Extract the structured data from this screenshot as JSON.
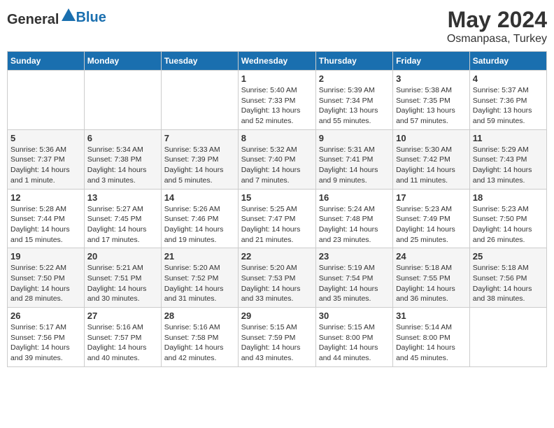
{
  "header": {
    "logo_general": "General",
    "logo_blue": "Blue",
    "month": "May 2024",
    "location": "Osmanpasa, Turkey"
  },
  "weekdays": [
    "Sunday",
    "Monday",
    "Tuesday",
    "Wednesday",
    "Thursday",
    "Friday",
    "Saturday"
  ],
  "weeks": [
    [
      {
        "day": "",
        "info": ""
      },
      {
        "day": "",
        "info": ""
      },
      {
        "day": "",
        "info": ""
      },
      {
        "day": "1",
        "info": "Sunrise: 5:40 AM\nSunset: 7:33 PM\nDaylight: 13 hours\nand 52 minutes."
      },
      {
        "day": "2",
        "info": "Sunrise: 5:39 AM\nSunset: 7:34 PM\nDaylight: 13 hours\nand 55 minutes."
      },
      {
        "day": "3",
        "info": "Sunrise: 5:38 AM\nSunset: 7:35 PM\nDaylight: 13 hours\nand 57 minutes."
      },
      {
        "day": "4",
        "info": "Sunrise: 5:37 AM\nSunset: 7:36 PM\nDaylight: 13 hours\nand 59 minutes."
      }
    ],
    [
      {
        "day": "5",
        "info": "Sunrise: 5:36 AM\nSunset: 7:37 PM\nDaylight: 14 hours\nand 1 minute."
      },
      {
        "day": "6",
        "info": "Sunrise: 5:34 AM\nSunset: 7:38 PM\nDaylight: 14 hours\nand 3 minutes."
      },
      {
        "day": "7",
        "info": "Sunrise: 5:33 AM\nSunset: 7:39 PM\nDaylight: 14 hours\nand 5 minutes."
      },
      {
        "day": "8",
        "info": "Sunrise: 5:32 AM\nSunset: 7:40 PM\nDaylight: 14 hours\nand 7 minutes."
      },
      {
        "day": "9",
        "info": "Sunrise: 5:31 AM\nSunset: 7:41 PM\nDaylight: 14 hours\nand 9 minutes."
      },
      {
        "day": "10",
        "info": "Sunrise: 5:30 AM\nSunset: 7:42 PM\nDaylight: 14 hours\nand 11 minutes."
      },
      {
        "day": "11",
        "info": "Sunrise: 5:29 AM\nSunset: 7:43 PM\nDaylight: 14 hours\nand 13 minutes."
      }
    ],
    [
      {
        "day": "12",
        "info": "Sunrise: 5:28 AM\nSunset: 7:44 PM\nDaylight: 14 hours\nand 15 minutes."
      },
      {
        "day": "13",
        "info": "Sunrise: 5:27 AM\nSunset: 7:45 PM\nDaylight: 14 hours\nand 17 minutes."
      },
      {
        "day": "14",
        "info": "Sunrise: 5:26 AM\nSunset: 7:46 PM\nDaylight: 14 hours\nand 19 minutes."
      },
      {
        "day": "15",
        "info": "Sunrise: 5:25 AM\nSunset: 7:47 PM\nDaylight: 14 hours\nand 21 minutes."
      },
      {
        "day": "16",
        "info": "Sunrise: 5:24 AM\nSunset: 7:48 PM\nDaylight: 14 hours\nand 23 minutes."
      },
      {
        "day": "17",
        "info": "Sunrise: 5:23 AM\nSunset: 7:49 PM\nDaylight: 14 hours\nand 25 minutes."
      },
      {
        "day": "18",
        "info": "Sunrise: 5:23 AM\nSunset: 7:50 PM\nDaylight: 14 hours\nand 26 minutes."
      }
    ],
    [
      {
        "day": "19",
        "info": "Sunrise: 5:22 AM\nSunset: 7:50 PM\nDaylight: 14 hours\nand 28 minutes."
      },
      {
        "day": "20",
        "info": "Sunrise: 5:21 AM\nSunset: 7:51 PM\nDaylight: 14 hours\nand 30 minutes."
      },
      {
        "day": "21",
        "info": "Sunrise: 5:20 AM\nSunset: 7:52 PM\nDaylight: 14 hours\nand 31 minutes."
      },
      {
        "day": "22",
        "info": "Sunrise: 5:20 AM\nSunset: 7:53 PM\nDaylight: 14 hours\nand 33 minutes."
      },
      {
        "day": "23",
        "info": "Sunrise: 5:19 AM\nSunset: 7:54 PM\nDaylight: 14 hours\nand 35 minutes."
      },
      {
        "day": "24",
        "info": "Sunrise: 5:18 AM\nSunset: 7:55 PM\nDaylight: 14 hours\nand 36 minutes."
      },
      {
        "day": "25",
        "info": "Sunrise: 5:18 AM\nSunset: 7:56 PM\nDaylight: 14 hours\nand 38 minutes."
      }
    ],
    [
      {
        "day": "26",
        "info": "Sunrise: 5:17 AM\nSunset: 7:56 PM\nDaylight: 14 hours\nand 39 minutes."
      },
      {
        "day": "27",
        "info": "Sunrise: 5:16 AM\nSunset: 7:57 PM\nDaylight: 14 hours\nand 40 minutes."
      },
      {
        "day": "28",
        "info": "Sunrise: 5:16 AM\nSunset: 7:58 PM\nDaylight: 14 hours\nand 42 minutes."
      },
      {
        "day": "29",
        "info": "Sunrise: 5:15 AM\nSunset: 7:59 PM\nDaylight: 14 hours\nand 43 minutes."
      },
      {
        "day": "30",
        "info": "Sunrise: 5:15 AM\nSunset: 8:00 PM\nDaylight: 14 hours\nand 44 minutes."
      },
      {
        "day": "31",
        "info": "Sunrise: 5:14 AM\nSunset: 8:00 PM\nDaylight: 14 hours\nand 45 minutes."
      },
      {
        "day": "",
        "info": ""
      }
    ]
  ]
}
